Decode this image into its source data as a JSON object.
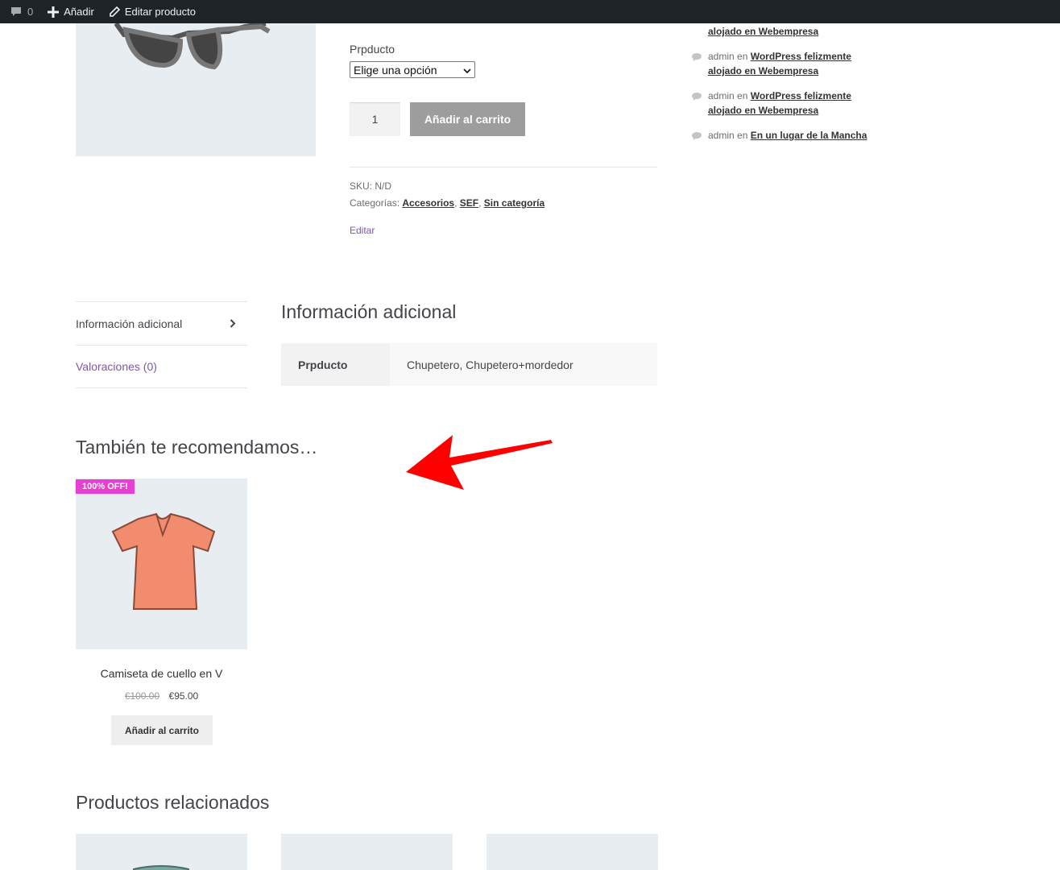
{
  "adminbar": {
    "comments_count": "0",
    "add_label": "Añadir",
    "edit_label": "Editar producto"
  },
  "product": {
    "variation_label": "Prpducto",
    "variation_selected": "Elige una opción",
    "quantity": "1",
    "add_to_cart": "Añadir al carrito",
    "sku_label": "SKU:",
    "sku_value": "N/D",
    "categories_label": "Categorías:",
    "categories": [
      "Accesorios",
      "SEF",
      "Sin categoría"
    ],
    "edit": "Editar"
  },
  "sidebar": {
    "top_fragment": "alojado en Webempresa",
    "comments": [
      {
        "author": "admin",
        "sep": "en",
        "post": "WordPress felizmente alojado en Webempresa"
      },
      {
        "author": "admin",
        "sep": "en",
        "post": "WordPress felizmente alojado en Webempresa"
      },
      {
        "author": "admin",
        "sep": "en",
        "post": "En un lugar de la Mancha"
      }
    ]
  },
  "tabs": {
    "items": [
      {
        "label": "Información adicional"
      },
      {
        "label": "Valoraciones (0)"
      }
    ],
    "panel_title": "Información adicional",
    "attribute_name": "Prpducto",
    "attribute_value": "Chupetero, Chupetero+mordedor"
  },
  "upsells": {
    "title": "También te recomendamos…",
    "badge": "100% OFF!",
    "name": "Camiseta de cuello en V",
    "old_price": "€100.00",
    "price": "€95.00",
    "button": "Añadir al carrito"
  },
  "related": {
    "title": "Productos relacionados"
  },
  "colors": {
    "accent": "#7f54b3",
    "sale_badge": "#e63fd2",
    "arrow": "#ff0000"
  }
}
